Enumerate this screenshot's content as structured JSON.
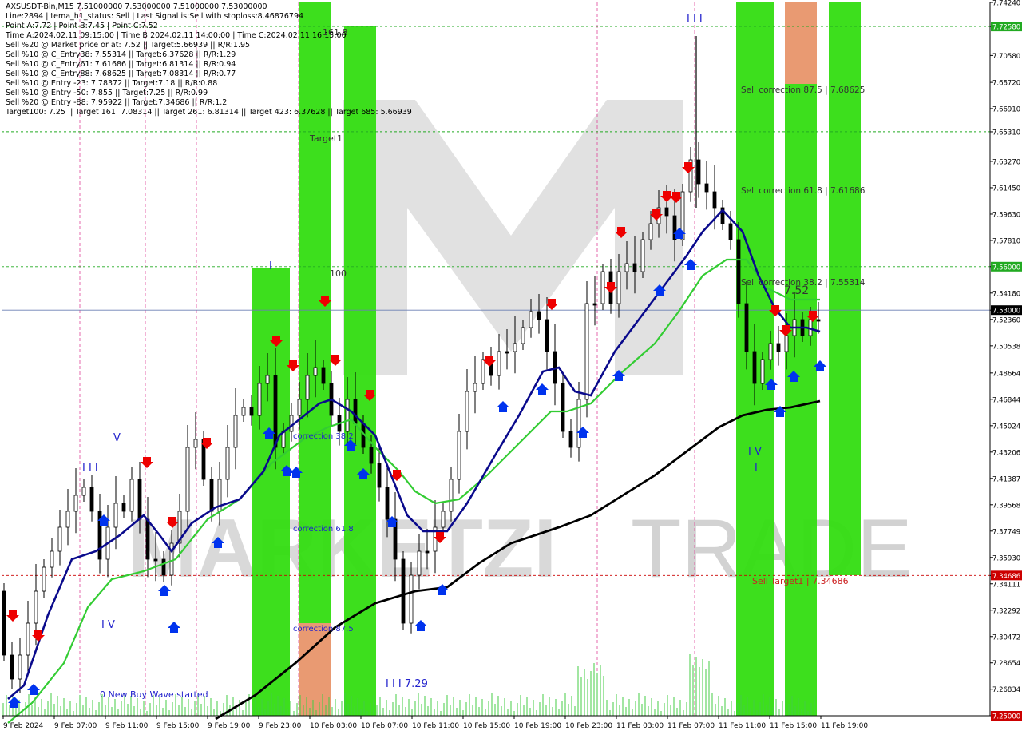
{
  "header": {
    "symbol_line": "AXSUSDT-Bin,M15  7.51000000 7.53000000 7.51000000 7.53000000",
    "lines": [
      "Line:2894 | tema_h1_status: Sell | Last Signal is:Sell with stoploss:8.46876794",
      "Point A:7.72 | Point B:7.45 | Point C:7.52",
      "Time A:2024.02.11 09:15:00 | Time B:2024.02.11 14:00:00 | Time C:2024.02.11 16:15:00",
      "Sell %20 @ Market price or at: 7.52 || Target:5.66939 || R/R:1.95",
      "Sell %10 @ C_Entry38: 7.55314 || Target:6.37628 || R/R:1.29",
      "Sell %10 @ C_Entry61: 7.61686 || Target:6.81314 || R/R:0.94",
      "Sell %10 @ C_Entry88: 7.68625 || Target:7.08314 || R/R:0.77",
      "Sell %10 @ Entry -23: 7.78372 || Target:7.18 || R/R:0.88",
      "Sell %10 @ Entry -50: 7.855 || Target:7.25 || R/R:0.99",
      "Sell %20 @ Entry -88: 7.95922 || Target:7.34686 || R/R:1.2",
      "Target100: 7.25 || Target 161: 7.08314 || Target 261: 6.81314 || Target 423: 6.37628 || Target 685: 5.66939"
    ]
  },
  "watermark": {
    "left": "MARKETZI",
    "right": "TRADE"
  },
  "colors": {
    "bull_candle": "#000000",
    "bear_candle": "#000000",
    "ma_fast": "#0a0a8c",
    "ma_mid": "#33cc33",
    "ma_slow": "#000000",
    "zone_green": "#33dd11",
    "zone_orange": "#e8956a",
    "sell_arrow": "#ee0000",
    "buy_arrow": "#0033ee",
    "current_price_line": "#6b7fb3"
  },
  "chart_data": {
    "type": "candlestick",
    "symbol": "AXSUSDT-Bin",
    "timeframe": "M15",
    "ylim": [
      7.25,
      7.7424
    ],
    "y_ticks": [
      "7.74240",
      "7.72580",
      "7.70580",
      "7.68720",
      "7.66910",
      "7.65310",
      "7.63270",
      "7.61450",
      "7.59630",
      "7.57810",
      "7.56000",
      "7.54180",
      "7.53000",
      "7.52360",
      "7.50538",
      "7.48664",
      "7.46844",
      "7.45024",
      "7.43206",
      "7.41387",
      "7.39568",
      "7.37749",
      "7.35930",
      "7.34686",
      "7.34111",
      "7.32292",
      "7.30472",
      "7.28654",
      "7.26834",
      "7.25000"
    ],
    "x_ticks": [
      "9 Feb 2024",
      "9 Feb 07:00",
      "9 Feb 11:00",
      "9 Feb 15:00",
      "9 Feb 19:00",
      "9 Feb 23:00",
      "10 Feb 03:00",
      "10 Feb 07:00",
      "10 Feb 11:00",
      "10 Feb 15:00",
      "10 Feb 19:00",
      "10 Feb 23:00",
      "11 Feb 03:00",
      "11 Feb 07:00",
      "11 Feb 11:00",
      "11 Feb 15:00",
      "11 Feb 19:00"
    ],
    "current_price": "7.53000",
    "highlighted_levels": [
      {
        "price": "7.72580",
        "color": "#22aa22"
      },
      {
        "price": "7.65314",
        "color": "#22aa22"
      },
      {
        "price": "7.56000",
        "color": "#22aa22"
      },
      {
        "price": "7.53000",
        "color": "#000000"
      },
      {
        "price": "7.34686",
        "color": "#cc0000"
      },
      {
        "price": "7.25000",
        "color": "#cc0000"
      }
    ],
    "annotations": [
      "161.8",
      "Target1",
      "100",
      "correction 38.2",
      "correction 61.8",
      "correction 87.5",
      "Sell correction 87.5 | 7.68625",
      "Sell correction 61.8 | 7.61686",
      "Sell correction 38.2 | 7.55314",
      "7.52",
      "Sell Target1 | 7.34686",
      "I I I 7.29",
      "0 New Buy Wave started",
      "I I I",
      "V",
      "I V",
      "I I I",
      "I V",
      "I",
      "I"
    ]
  }
}
